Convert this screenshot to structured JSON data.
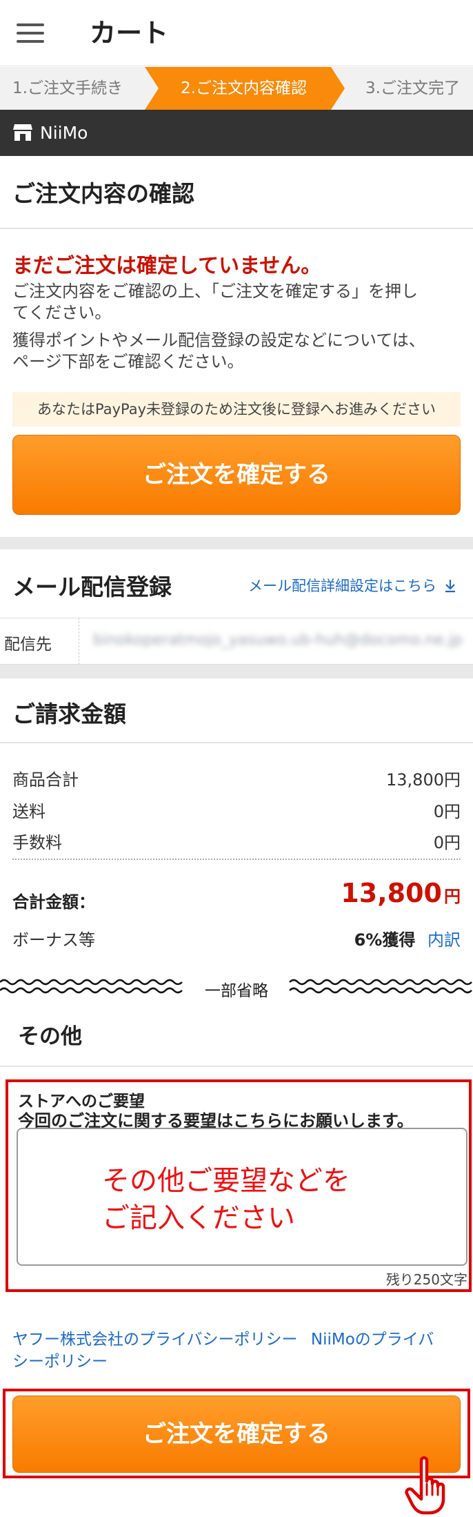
{
  "header": {
    "title": "カート",
    "menu_icon": "hamburger-menu-icon"
  },
  "steps": [
    {
      "label": "1.ご注文手続き",
      "active": false
    },
    {
      "label": "2.ご注文内容確認",
      "active": true
    },
    {
      "label": "3.ご注文完了",
      "active": false
    }
  ],
  "store": {
    "icon": "store-icon",
    "name": "NiiMo"
  },
  "confirm_section": {
    "title": "ご注文内容の確認",
    "warning": "まだご注文は確定していません。",
    "notice1_line1": "ご注文内容をご確認の上、「ご注文を確定する」を押し",
    "notice1_line2": "てください。",
    "notice2_line1": "獲得ポイントやメール配信登録の設定などについては、",
    "notice2_line2": "ページ下部をご確認ください。",
    "paypay_notice": "あなたはPayPay未登録のため注文後に登録へお進みください",
    "confirm_button": "ご注文を確定する"
  },
  "mail_section": {
    "title": "メール配信登録",
    "settings_link": "メール配信詳細設定はこちら",
    "link_icon": "download-arrow-icon",
    "recipient_label": "配信先",
    "recipient_value": "binokoperatmojo_yasuwo.ub-huh@docomo.ne.jp"
  },
  "billing_section": {
    "title": "ご請求金額",
    "rows": [
      {
        "label": "商品合計",
        "value": "13,800円"
      },
      {
        "label": "送料",
        "value": "0円"
      },
      {
        "label": "手数料",
        "value": "0円"
      }
    ],
    "total_label": "合計金額：",
    "total_amount": "13,800",
    "total_unit": "円",
    "bonus_label": "ボーナス等",
    "bonus_value": "6%獲得",
    "bonus_link": "内訳"
  },
  "omitted_label": "一部省略",
  "other_section": {
    "title": "その他",
    "request_label": "ストアへのご要望",
    "request_hint": "今回のご注文に関する要望はこちらにお願いします。",
    "placeholder_line1": "その他ご要望などを",
    "placeholder_line2": "ご記入ください",
    "char_remaining": "残り250文字"
  },
  "footer": {
    "privacy_link_1": "ヤフー株式会社のプライバシーポリシー",
    "privacy_link_2_line1": "NiiMoのプライバ",
    "privacy_link_2_line2": "シーポリシー",
    "confirm_button": "ご注文を確定する"
  },
  "colors": {
    "accent_orange": "#f98a0a",
    "warning_red": "#cc1100",
    "link_blue": "#1b6ac8",
    "highlight_red": "#dd0000",
    "store_bar": "#333333"
  },
  "cursor_icon": "pointer-hand-icon"
}
